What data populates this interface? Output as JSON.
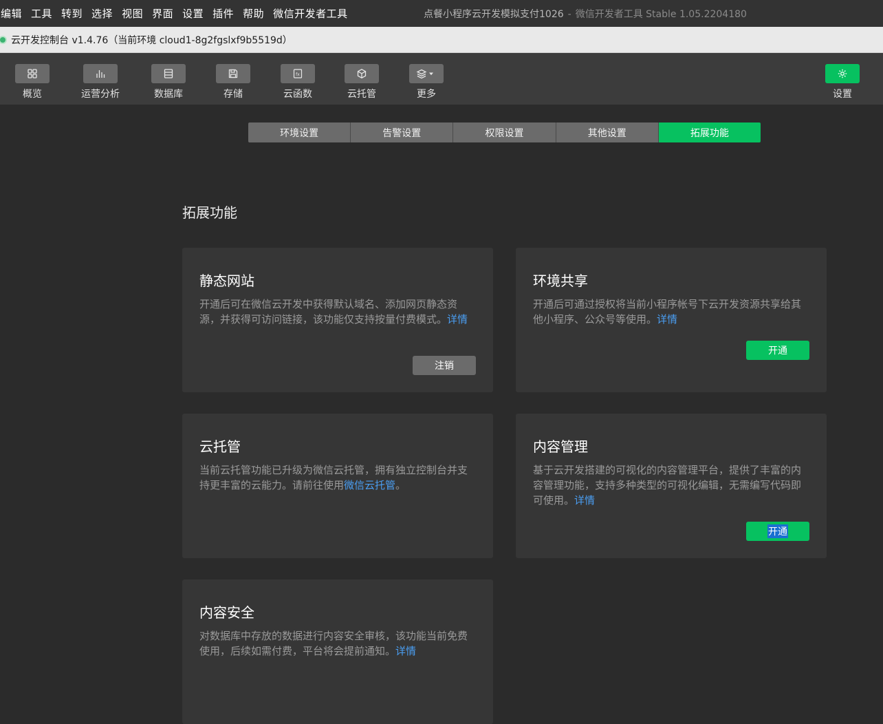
{
  "menubar": {
    "items": [
      "编辑",
      "工具",
      "转到",
      "选择",
      "视图",
      "界面",
      "设置",
      "插件",
      "帮助",
      "微信开发者工具"
    ],
    "window_title": "点餐小程序云开发模拟支付1026",
    "window_sep": "-",
    "window_subtitle": "微信开发者工具 Stable 1.05.2204180"
  },
  "tab": {
    "title": "云开发控制台 v1.4.76（当前环境 cloud1-8g2fgslxf9b5519d）"
  },
  "toolbar": {
    "items": [
      {
        "label": "概览",
        "icon": "grid-icon"
      },
      {
        "label": "运营分析",
        "icon": "bar-chart-icon"
      },
      {
        "label": "数据库",
        "icon": "database-icon"
      },
      {
        "label": "存储",
        "icon": "save-icon"
      },
      {
        "label": "云函数",
        "icon": "function-icon"
      },
      {
        "label": "云托管",
        "icon": "cube-icon"
      },
      {
        "label": "更多",
        "icon": "layers-icon"
      }
    ],
    "settings_label": "设置"
  },
  "subtabs": {
    "items": [
      "环境设置",
      "告警设置",
      "权限设置",
      "其他设置",
      "拓展功能"
    ],
    "active_index": 4
  },
  "section": {
    "title": "拓展功能"
  },
  "cards": [
    {
      "title": "静态网站",
      "desc": "开通后可在微信云开发中获得默认域名、添加网页静态资源，并获得可访问链接，该功能仅支持按量付费模式。",
      "link": "详情",
      "action": "注销"
    },
    {
      "title": "环境共享",
      "desc": "开通后可通过授权将当前小程序帐号下云开发资源共享给其他小程序、公众号等使用。",
      "link": "详情",
      "action": "开通"
    },
    {
      "title": "云托管",
      "desc": "当前云托管功能已升级为微信云托管，拥有独立控制台并支持更丰富的云能力。请前往使用",
      "link": "微信云托管",
      "suffix": "。"
    },
    {
      "title": "内容管理",
      "desc": "基于云开发搭建的可视化的内容管理平台，提供了丰富的内容管理功能，支持多种类型的可视化编辑，无需编写代码即可使用。",
      "link": "详情",
      "action": "开通"
    },
    {
      "title": "内容安全",
      "desc": "对数据库中存放的数据进行内容安全审核，该功能当前免费使用，后续如需付费，平台将会提前通知。",
      "link": "详情"
    }
  ]
}
